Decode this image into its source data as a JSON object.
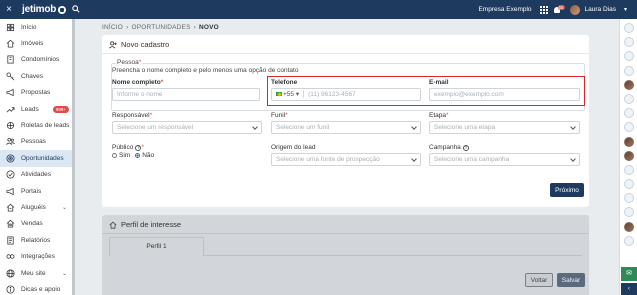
{
  "topbar": {
    "close": "×",
    "logo": "jetimob",
    "company": "Empresa Exemplo",
    "notif_count": "55",
    "user": "Laura Dias",
    "caret": "▾"
  },
  "sidebar": {
    "items": [
      {
        "label": "Início",
        "icon": "home-icon"
      },
      {
        "label": "Imóveis",
        "icon": "house-icon"
      },
      {
        "label": "Condomínios",
        "icon": "building-icon"
      },
      {
        "label": "Chaves",
        "icon": "key-icon"
      },
      {
        "label": "Propostas",
        "icon": "megaphone-icon"
      },
      {
        "label": "Leads",
        "icon": "leads-icon",
        "badge": "999+"
      },
      {
        "label": "Roletas de leads",
        "icon": "roulette-icon"
      },
      {
        "label": "Pessoas",
        "icon": "people-icon"
      },
      {
        "label": "Oportunidades",
        "icon": "target-icon",
        "active": true
      },
      {
        "label": "Atividades",
        "icon": "check-icon"
      },
      {
        "label": "Portais",
        "icon": "portal-icon"
      },
      {
        "label": "Aluguéis",
        "icon": "rent-icon",
        "chevron": "⌄"
      },
      {
        "label": "Vendas",
        "icon": "sales-icon"
      },
      {
        "label": "Relatórios",
        "icon": "report-icon"
      },
      {
        "label": "Integrações",
        "icon": "integration-icon"
      },
      {
        "label": "Meu site",
        "icon": "globe-icon",
        "chevron": "⌄"
      },
      {
        "label": "Dicas e apoio",
        "icon": "info-icon"
      }
    ]
  },
  "breadcrumb": {
    "home": "INÍCIO",
    "section": "OPORTUNIDADES",
    "current": "NOVO",
    "sep": "›"
  },
  "form": {
    "title": "Novo cadastro",
    "pessoa_legend": "Pessoa",
    "pessoa_hint": "Preencha o nome completo e pelo menos uma opção de contato",
    "required_mark": "*",
    "nome": {
      "label": "Nome completo",
      "placeholder": "Informe o nome"
    },
    "telefone": {
      "label": "Telefone",
      "country_code": "+55 ▾",
      "placeholder": "(11) 96123-4567"
    },
    "email": {
      "label": "E-mail",
      "placeholder": "exemplo@exemplo.com"
    },
    "responsavel": {
      "label": "Responsável",
      "placeholder": "Selecione um responsável"
    },
    "funil": {
      "label": "Funil",
      "placeholder": "Selecione um funil"
    },
    "etapa": {
      "label": "Etapa",
      "placeholder": "Selecione uma etapa"
    },
    "publico": {
      "label": "Público",
      "help": "?",
      "options": [
        "Sim",
        "Não"
      ],
      "selected": "Não"
    },
    "origem": {
      "label": "Origem do lead",
      "placeholder": "Selecione uma fonte de prospecção"
    },
    "campanha": {
      "label": "Campanha",
      "help": "?",
      "placeholder": "Selecione uma campanha"
    },
    "next_button": "Próximo"
  },
  "interest": {
    "title": "Perfil de interesse",
    "tab": "Perfil 1",
    "back_button": "Voltar",
    "save_button": "Salvar"
  },
  "rail": {
    "chat_icon": "chat-icon",
    "collapse": "‹"
  },
  "colors": {
    "primary": "#1f3a5f",
    "highlight": "#d9262c",
    "active_bg": "#dbe7f3",
    "badge": "#e04b4b"
  }
}
